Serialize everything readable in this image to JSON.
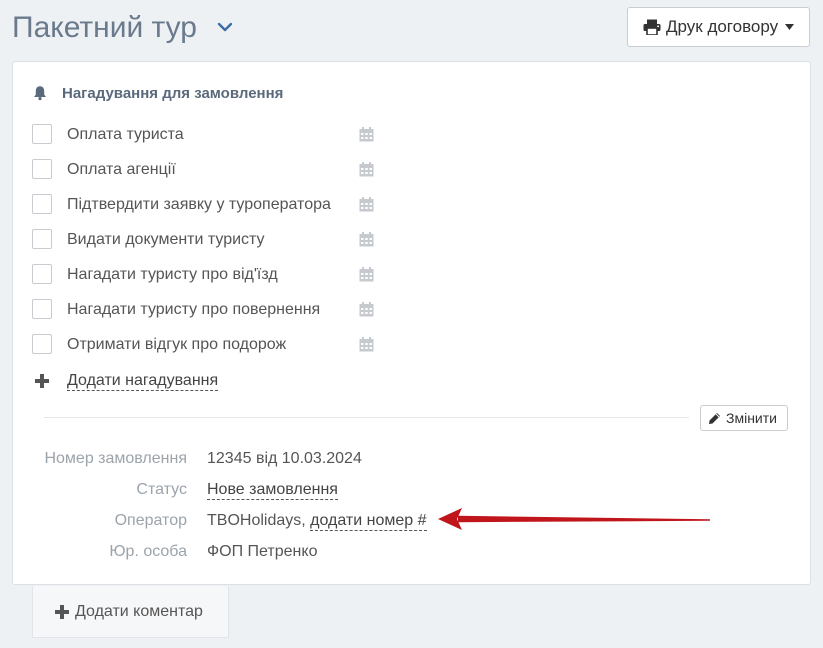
{
  "header": {
    "title": "Пакетний тур",
    "print_button_label": "Друк договору"
  },
  "reminders_panel": {
    "heading": "Нагадування для замовлення",
    "items": [
      {
        "label": "Оплата туриста",
        "checked": false
      },
      {
        "label": "Оплата агенції",
        "checked": false
      },
      {
        "label": "Підтвердити заявку у туроператора",
        "checked": false
      },
      {
        "label": "Видати документи туристу",
        "checked": false
      },
      {
        "label": "Нагадати туристу про від'їзд",
        "checked": false
      },
      {
        "label": "Нагадати туристу про повернення",
        "checked": false
      },
      {
        "label": "Отримати відгук про подорож",
        "checked": false
      }
    ],
    "add_reminder_label": "Додати нагадування"
  },
  "order_details": {
    "edit_button_label": "Змінити",
    "order_number_label": "Номер замовлення",
    "order_number_value": "12345 від 10.03.2024",
    "status_label": "Статус",
    "status_value": "Нове замовлення",
    "operator_label": "Оператор",
    "operator_name": "TBOHolidays",
    "operator_separator": ",",
    "operator_add_number_link": "додати номер #",
    "legal_entity_label": "Юр. особа",
    "legal_entity_value": "ФОП Петренко"
  },
  "footer": {
    "add_comment_label": "Додати коментар"
  },
  "icons": {
    "title_dropdown": "chevron-down-icon",
    "print": "printer-icon",
    "print_dropdown": "caret-down-icon",
    "reminder_heading": "bell-icon",
    "reminder_date": "calendar-icon",
    "add": "plus-icon",
    "edit": "pencil-icon"
  },
  "colors": {
    "title": "#6a7a8c",
    "annotation_arrow": "#c0151b",
    "panel_background": "#ffffff",
    "page_background": "#eef1f4"
  }
}
